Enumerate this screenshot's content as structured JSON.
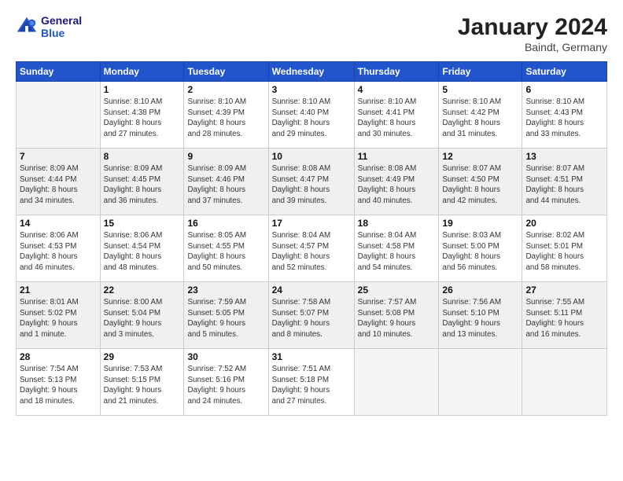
{
  "header": {
    "logo_line1": "General",
    "logo_line2": "Blue",
    "month": "January 2024",
    "location": "Baindt, Germany"
  },
  "days_of_week": [
    "Sunday",
    "Monday",
    "Tuesday",
    "Wednesday",
    "Thursday",
    "Friday",
    "Saturday"
  ],
  "weeks": [
    [
      {
        "day": "",
        "info": ""
      },
      {
        "day": "1",
        "info": "Sunrise: 8:10 AM\nSunset: 4:38 PM\nDaylight: 8 hours\nand 27 minutes."
      },
      {
        "day": "2",
        "info": "Sunrise: 8:10 AM\nSunset: 4:39 PM\nDaylight: 8 hours\nand 28 minutes."
      },
      {
        "day": "3",
        "info": "Sunrise: 8:10 AM\nSunset: 4:40 PM\nDaylight: 8 hours\nand 29 minutes."
      },
      {
        "day": "4",
        "info": "Sunrise: 8:10 AM\nSunset: 4:41 PM\nDaylight: 8 hours\nand 30 minutes."
      },
      {
        "day": "5",
        "info": "Sunrise: 8:10 AM\nSunset: 4:42 PM\nDaylight: 8 hours\nand 31 minutes."
      },
      {
        "day": "6",
        "info": "Sunrise: 8:10 AM\nSunset: 4:43 PM\nDaylight: 8 hours\nand 33 minutes."
      }
    ],
    [
      {
        "day": "7",
        "info": "Sunrise: 8:09 AM\nSunset: 4:44 PM\nDaylight: 8 hours\nand 34 minutes."
      },
      {
        "day": "8",
        "info": "Sunrise: 8:09 AM\nSunset: 4:45 PM\nDaylight: 8 hours\nand 36 minutes."
      },
      {
        "day": "9",
        "info": "Sunrise: 8:09 AM\nSunset: 4:46 PM\nDaylight: 8 hours\nand 37 minutes."
      },
      {
        "day": "10",
        "info": "Sunrise: 8:08 AM\nSunset: 4:47 PM\nDaylight: 8 hours\nand 39 minutes."
      },
      {
        "day": "11",
        "info": "Sunrise: 8:08 AM\nSunset: 4:49 PM\nDaylight: 8 hours\nand 40 minutes."
      },
      {
        "day": "12",
        "info": "Sunrise: 8:07 AM\nSunset: 4:50 PM\nDaylight: 8 hours\nand 42 minutes."
      },
      {
        "day": "13",
        "info": "Sunrise: 8:07 AM\nSunset: 4:51 PM\nDaylight: 8 hours\nand 44 minutes."
      }
    ],
    [
      {
        "day": "14",
        "info": "Sunrise: 8:06 AM\nSunset: 4:53 PM\nDaylight: 8 hours\nand 46 minutes."
      },
      {
        "day": "15",
        "info": "Sunrise: 8:06 AM\nSunset: 4:54 PM\nDaylight: 8 hours\nand 48 minutes."
      },
      {
        "day": "16",
        "info": "Sunrise: 8:05 AM\nSunset: 4:55 PM\nDaylight: 8 hours\nand 50 minutes."
      },
      {
        "day": "17",
        "info": "Sunrise: 8:04 AM\nSunset: 4:57 PM\nDaylight: 8 hours\nand 52 minutes."
      },
      {
        "day": "18",
        "info": "Sunrise: 8:04 AM\nSunset: 4:58 PM\nDaylight: 8 hours\nand 54 minutes."
      },
      {
        "day": "19",
        "info": "Sunrise: 8:03 AM\nSunset: 5:00 PM\nDaylight: 8 hours\nand 56 minutes."
      },
      {
        "day": "20",
        "info": "Sunrise: 8:02 AM\nSunset: 5:01 PM\nDaylight: 8 hours\nand 58 minutes."
      }
    ],
    [
      {
        "day": "21",
        "info": "Sunrise: 8:01 AM\nSunset: 5:02 PM\nDaylight: 9 hours\nand 1 minute."
      },
      {
        "day": "22",
        "info": "Sunrise: 8:00 AM\nSunset: 5:04 PM\nDaylight: 9 hours\nand 3 minutes."
      },
      {
        "day": "23",
        "info": "Sunrise: 7:59 AM\nSunset: 5:05 PM\nDaylight: 9 hours\nand 5 minutes."
      },
      {
        "day": "24",
        "info": "Sunrise: 7:58 AM\nSunset: 5:07 PM\nDaylight: 9 hours\nand 8 minutes."
      },
      {
        "day": "25",
        "info": "Sunrise: 7:57 AM\nSunset: 5:08 PM\nDaylight: 9 hours\nand 10 minutes."
      },
      {
        "day": "26",
        "info": "Sunrise: 7:56 AM\nSunset: 5:10 PM\nDaylight: 9 hours\nand 13 minutes."
      },
      {
        "day": "27",
        "info": "Sunrise: 7:55 AM\nSunset: 5:11 PM\nDaylight: 9 hours\nand 16 minutes."
      }
    ],
    [
      {
        "day": "28",
        "info": "Sunrise: 7:54 AM\nSunset: 5:13 PM\nDaylight: 9 hours\nand 18 minutes."
      },
      {
        "day": "29",
        "info": "Sunrise: 7:53 AM\nSunset: 5:15 PM\nDaylight: 9 hours\nand 21 minutes."
      },
      {
        "day": "30",
        "info": "Sunrise: 7:52 AM\nSunset: 5:16 PM\nDaylight: 9 hours\nand 24 minutes."
      },
      {
        "day": "31",
        "info": "Sunrise: 7:51 AM\nSunset: 5:18 PM\nDaylight: 9 hours\nand 27 minutes."
      },
      {
        "day": "",
        "info": ""
      },
      {
        "day": "",
        "info": ""
      },
      {
        "day": "",
        "info": ""
      }
    ]
  ]
}
